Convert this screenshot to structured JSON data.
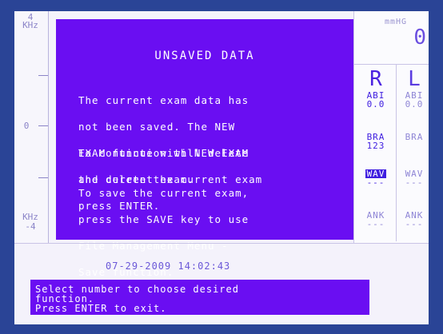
{
  "scale": {
    "top_label": "4\nKHz",
    "top_num": "4",
    "top_unit": "KHz",
    "mid_label": "0",
    "bottom_unit": "KHz",
    "bottom_num": "-4"
  },
  "modal": {
    "title": "UNSAVED DATA",
    "para1": [
      "The current exam data has",
      "not been saved. The NEW",
      "EXAM function will delete",
      "the current exam."
    ],
    "para2": [
      "To continue with NEW EXAM",
      "and delete the current exam",
      "press ENTER."
    ],
    "para3": [
      "To save the current exam,",
      "press the SAVE key to use",
      "File Management Menu -",
      "Save function."
    ]
  },
  "panel": {
    "unit": "mmHG",
    "value": "0",
    "right_letter": "R",
    "left_letter": "L",
    "right": {
      "abi_label": "ABI",
      "abi_value": "0.0",
      "bra_label": "BRA",
      "bra_value": "123",
      "wav_label": "WAV",
      "wav_value": "---",
      "ank_label": "ANK",
      "ank_value": "---"
    },
    "left": {
      "abi_label": "ABI",
      "abi_value": "0.0",
      "bra_label": "BRA",
      "bra_value": "",
      "wav_label": "WAV",
      "wav_value": "---",
      "ank_label": "ANK",
      "ank_value": "---"
    },
    "highlight_color": "#3f1ee0"
  },
  "footer": {
    "timestamp": "07-29-2009 14:02:43",
    "prompt_lines": [
      "Select number to choose desired",
      "function.",
      "Press ENTER to exit."
    ]
  },
  "colors": {
    "modal_bg": "#6a0ef2",
    "screen_bg": "#f4f2fb",
    "bezel": "#2a4496"
  }
}
